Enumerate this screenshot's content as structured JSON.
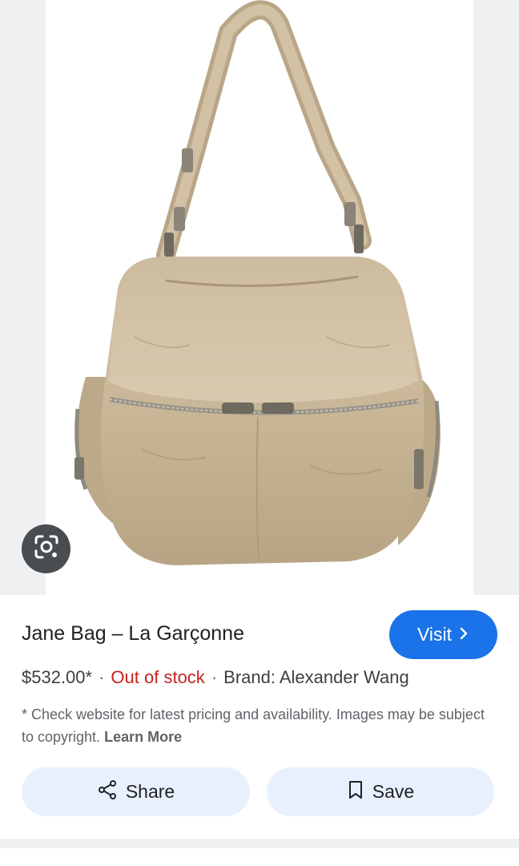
{
  "product": {
    "title": "Jane Bag – La Garçonne",
    "price": "$532.00*",
    "separator": "·",
    "stock_status": "Out of stock",
    "brand": "Brand: Alexander Wang",
    "disclaimer": "* Check website for latest pricing and availability. Images may be subject to copyright.",
    "learn_more": "Learn More"
  },
  "buttons": {
    "visit_label": "Visit",
    "share_label": "Share",
    "save_label": "Save"
  },
  "icons": {
    "lens": "google-lens-icon",
    "visit": "chevron-right-icon",
    "share": "share-icon",
    "save": "bookmark-icon"
  },
  "colors": {
    "accent": "#1a73e8",
    "stock": "#c5221f",
    "button_bg": "#e8f0fe",
    "bag": "#c9b79c"
  }
}
